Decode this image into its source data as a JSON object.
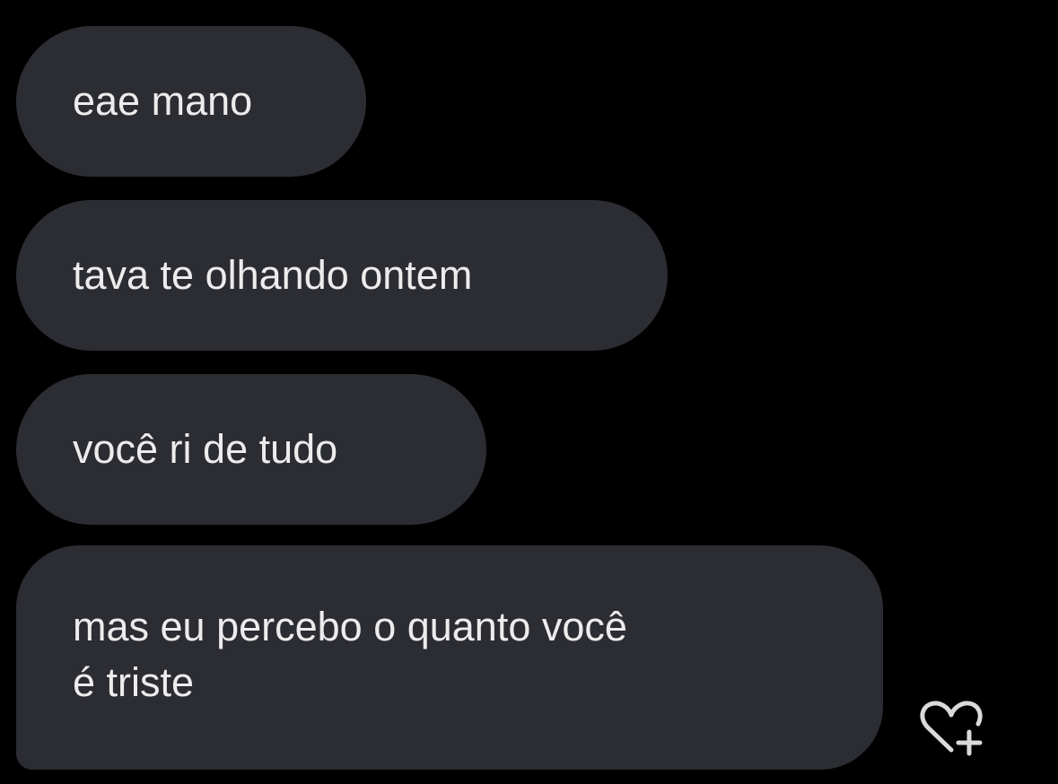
{
  "messages": [
    {
      "text": "eae mano"
    },
    {
      "text": "tava te olhando ontem"
    },
    {
      "text": "você ri de tudo"
    },
    {
      "lines": [
        "mas eu percebo o quanto você",
        "é triste"
      ]
    }
  ],
  "icons": {
    "reaction": "heart-plus-icon"
  },
  "colors": {
    "background": "#000000",
    "bubble": "#2C2D33",
    "text": "#ECECEC"
  }
}
